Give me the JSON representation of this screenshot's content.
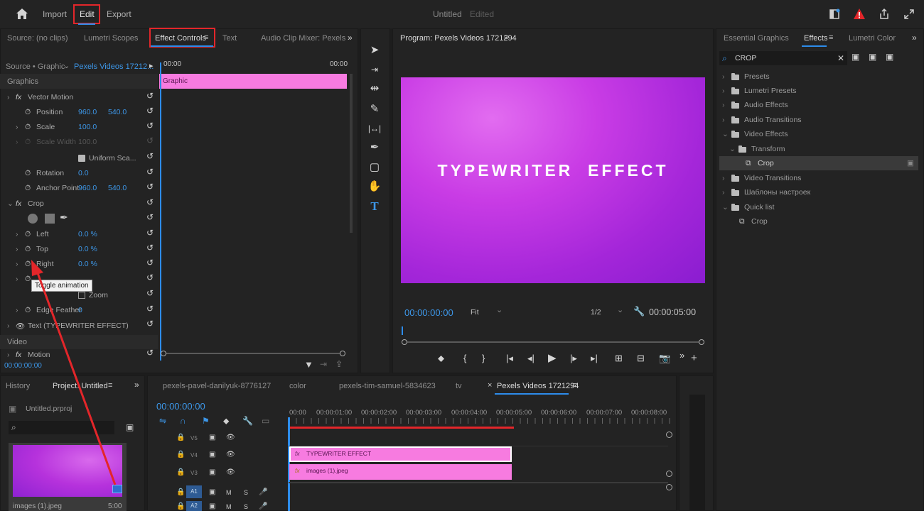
{
  "topbar": {
    "home_icon": "home-icon",
    "nav": [
      "Import",
      "Edit",
      "Export"
    ],
    "title": "Untitled",
    "status": "Edited"
  },
  "left_panel": {
    "tabs": [
      "Source: (no clips)",
      "Lumetri Scopes",
      "Effect Controls",
      "Text",
      "Audio Clip Mixer: Pexels"
    ],
    "source_label": "Source • Graphic",
    "clip_label": "Pexels Videos 17212...",
    "time_start": "00:00",
    "time_end": "00:00",
    "graphic_bar_label": "Graphic",
    "current_time": "00:00:00:00",
    "section_graphics": "Graphics",
    "section_video": "Video",
    "properties": [
      {
        "name": "Vector Motion",
        "kind": "fx"
      },
      {
        "name": "Position",
        "v1": "960.0",
        "v2": "540.0"
      },
      {
        "name": "Scale",
        "v1": "100.0"
      },
      {
        "name": "Scale Width",
        "v1": "100.0"
      },
      {
        "name": "Uniform Sca..."
      },
      {
        "name": "Rotation",
        "v1": "0.0"
      },
      {
        "name": "Anchor Point",
        "v1": "960.0",
        "v2": "540.0"
      },
      {
        "name": "Crop",
        "kind": "fx"
      },
      {
        "name": "Left",
        "v1": "0.0 %"
      },
      {
        "name": "Top",
        "v1": "0.0 %"
      },
      {
        "name": "Right",
        "v1": "0.0 %"
      },
      {
        "name": "Zoom"
      },
      {
        "name": "Edge Feather",
        "v1": "0"
      },
      {
        "name": "Text (TYPEWRITER EFFECT)"
      },
      {
        "name": "Motion",
        "kind": "fx"
      }
    ],
    "tooltip": "Toggle animation"
  },
  "program": {
    "title": "Program: Pexels Videos 1721294",
    "video_text": "TYPEWRITER  EFFECT",
    "timecode": "00:00:00:00",
    "fit": "Fit",
    "resolution": "1/2",
    "duration": "00:00:05:00"
  },
  "effects_panel": {
    "tabs": [
      "Essential Graphics",
      "Effects",
      "Lumetri Color"
    ],
    "search_value": "CROP",
    "tree": [
      "Presets",
      "Lumetri Presets",
      "Audio Effects",
      "Audio Transitions",
      "Video Effects",
      "Transform",
      "Crop",
      "Video Transitions",
      "Шаблоны настроек",
      "Quick list",
      "Crop"
    ]
  },
  "project_panel": {
    "tabs": [
      "History",
      "Project: Untitled"
    ],
    "project_file": "Untitled.prproj",
    "thumb_name": "images (1).jpeg",
    "thumb_duration": "5:00"
  },
  "timeline": {
    "tabs": [
      "pexels-pavel-danilyuk-8776127",
      "color",
      "pexels-tim-samuel-5834623",
      "tv",
      "Pexels Videos 1721294"
    ],
    "timecode": "00:00:00:00",
    "ruler": [
      "00:00",
      "00:00:01:00",
      "00:00:02:00",
      "00:00:03:00",
      "00:00:04:00",
      "00:00:05:00",
      "00:00:06:00",
      "00:00:07:00",
      "00:00:08:00"
    ],
    "tracks": [
      "V5",
      "V4",
      "V3",
      "A1",
      "A2"
    ],
    "clips": [
      {
        "label": "TYPEWRITER EFFECT",
        "fx": "fx"
      },
      {
        "label": "images (1).jpeg",
        "fx": "fx"
      }
    ]
  },
  "colors": {
    "accent_blue": "#3d97e8",
    "highlight_red": "#e3262a",
    "clip_pink": "#f77be0"
  }
}
